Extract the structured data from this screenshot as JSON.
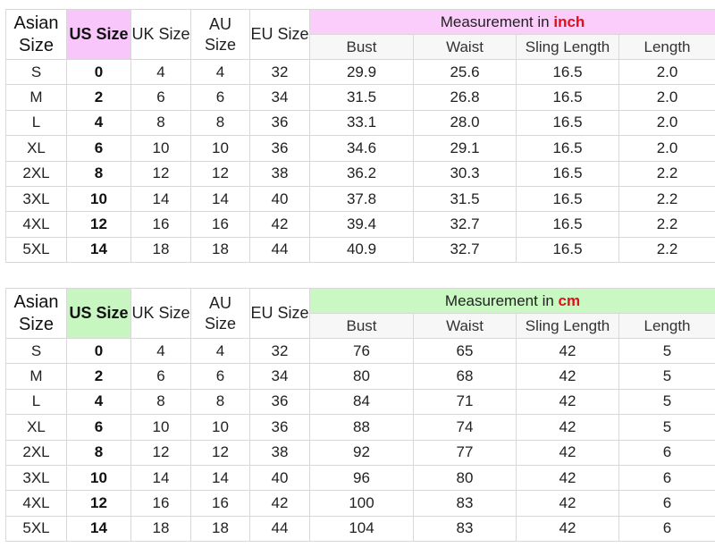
{
  "headers": {
    "asian": "Asian Size",
    "us": "US Size",
    "uk": "UK Size",
    "au": "AU Size",
    "eu": "EU Size",
    "measurement_prefix": "Measurement in",
    "bust": "Bust",
    "waist": "Waist",
    "sling_length": "Sling Length",
    "length": "Length"
  },
  "inch_table": {
    "unit": "inch",
    "accent_color": "#fbcdfb",
    "rows": [
      {
        "asian": "S",
        "us": "0",
        "uk": "4",
        "au": "4",
        "eu": "32",
        "bust": "29.9",
        "waist": "25.6",
        "sling": "16.5",
        "length": "2.0"
      },
      {
        "asian": "M",
        "us": "2",
        "uk": "6",
        "au": "6",
        "eu": "34",
        "bust": "31.5",
        "waist": "26.8",
        "sling": "16.5",
        "length": "2.0"
      },
      {
        "asian": "L",
        "us": "4",
        "uk": "8",
        "au": "8",
        "eu": "36",
        "bust": "33.1",
        "waist": "28.0",
        "sling": "16.5",
        "length": "2.0"
      },
      {
        "asian": "XL",
        "us": "6",
        "uk": "10",
        "au": "10",
        "eu": "36",
        "bust": "34.6",
        "waist": "29.1",
        "sling": "16.5",
        "length": "2.0"
      },
      {
        "asian": "2XL",
        "us": "8",
        "uk": "12",
        "au": "12",
        "eu": "38",
        "bust": "36.2",
        "waist": "30.3",
        "sling": "16.5",
        "length": "2.2"
      },
      {
        "asian": "3XL",
        "us": "10",
        "uk": "14",
        "au": "14",
        "eu": "40",
        "bust": "37.8",
        "waist": "31.5",
        "sling": "16.5",
        "length": "2.2"
      },
      {
        "asian": "4XL",
        "us": "12",
        "uk": "16",
        "au": "16",
        "eu": "42",
        "bust": "39.4",
        "waist": "32.7",
        "sling": "16.5",
        "length": "2.2"
      },
      {
        "asian": "5XL",
        "us": "14",
        "uk": "18",
        "au": "18",
        "eu": "44",
        "bust": "40.9",
        "waist": "32.7",
        "sling": "16.5",
        "length": "2.2"
      }
    ]
  },
  "cm_table": {
    "unit": "cm",
    "accent_color": "#c9f8c2",
    "rows": [
      {
        "asian": "S",
        "us": "0",
        "uk": "4",
        "au": "4",
        "eu": "32",
        "bust": "76",
        "waist": "65",
        "sling": "42",
        "length": "5"
      },
      {
        "asian": "M",
        "us": "2",
        "uk": "6",
        "au": "6",
        "eu": "34",
        "bust": "80",
        "waist": "68",
        "sling": "42",
        "length": "5"
      },
      {
        "asian": "L",
        "us": "4",
        "uk": "8",
        "au": "8",
        "eu": "36",
        "bust": "84",
        "waist": "71",
        "sling": "42",
        "length": "5"
      },
      {
        "asian": "XL",
        "us": "6",
        "uk": "10",
        "au": "10",
        "eu": "36",
        "bust": "88",
        "waist": "74",
        "sling": "42",
        "length": "5"
      },
      {
        "asian": "2XL",
        "us": "8",
        "uk": "12",
        "au": "12",
        "eu": "38",
        "bust": "92",
        "waist": "77",
        "sling": "42",
        "length": "6"
      },
      {
        "asian": "3XL",
        "us": "10",
        "uk": "14",
        "au": "14",
        "eu": "40",
        "bust": "96",
        "waist": "80",
        "sling": "42",
        "length": "6"
      },
      {
        "asian": "4XL",
        "us": "12",
        "uk": "16",
        "au": "16",
        "eu": "42",
        "bust": "100",
        "waist": "83",
        "sling": "42",
        "length": "6"
      },
      {
        "asian": "5XL",
        "us": "14",
        "uk": "18",
        "au": "18",
        "eu": "44",
        "bust": "104",
        "waist": "83",
        "sling": "42",
        "length": "6"
      }
    ]
  }
}
